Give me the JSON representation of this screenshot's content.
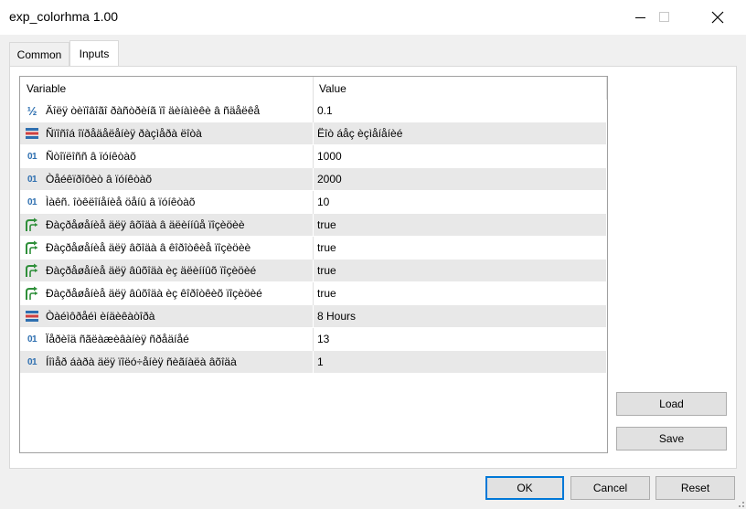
{
  "window": {
    "title": "exp_colorhma 1.00"
  },
  "tabs": [
    {
      "label": "Common"
    },
    {
      "label": "Inputs"
    }
  ],
  "grid": {
    "col_variable": "Variable",
    "col_value": "Value",
    "rows": [
      {
        "icon": "fraction-icon",
        "name": "Äîëÿ òèïîâîãî ðàñòðèíã ïî äèíàìèêè â ñäåëêå",
        "value": "0.1"
      },
      {
        "icon": "enum-icon",
        "name": "Ñïîñîá îïðåäåëåíèÿ ðàçìåðà ëîòà",
        "value": "Ëîò áåç èçìåíåíèé"
      },
      {
        "icon": "integer-icon",
        "name": "Ñòîïëîññ â ïóíêòàõ",
        "value": "1000"
      },
      {
        "icon": "integer-icon",
        "name": "Òåéêïðîôèò â ïóíêòàõ",
        "value": "2000"
      },
      {
        "icon": "integer-icon",
        "name": "Ìàêñ. îòêëîíåíèå öåíû â ïóíêòàõ",
        "value": "10"
      },
      {
        "icon": "bool-icon",
        "name": "Ðàçðåøåíèå äëÿ âõîäà â äëèííûå ïîçèöèè",
        "value": "true"
      },
      {
        "icon": "bool-icon",
        "name": "Ðàçðåøåíèå äëÿ âõîäà â êîðîòêèå ïîçèöèè",
        "value": "true"
      },
      {
        "icon": "bool-icon",
        "name": "Ðàçðåøåíèå äëÿ âûõîäà èç äëèííûõ ïîçèöèé",
        "value": "true"
      },
      {
        "icon": "bool-icon",
        "name": "Ðàçðåøåíèå äëÿ âûõîäà èç êîðîòêèõ ïîçèöèé",
        "value": "true"
      },
      {
        "icon": "enum-icon",
        "name": "Òàéìôðåéì èíäèêàòîðà",
        "value": "8 Hours"
      },
      {
        "icon": "integer-icon",
        "name": "Ïåðèîä ñãëàæèâàíèÿ ñðåäíåé",
        "value": "13"
      },
      {
        "icon": "integer-icon",
        "name": "Íîìåð áàðà äëÿ ïîëó÷åíèÿ ñèãíàëà âõîäà",
        "value": "1"
      }
    ]
  },
  "side_buttons": {
    "load": "Load",
    "save": "Save"
  },
  "footer_buttons": {
    "ok": "OK",
    "cancel": "Cancel",
    "reset": "Reset"
  },
  "colors": {
    "accent": "#0078d7",
    "icon_blue": "#2e6fb0",
    "icon_green": "#2f8f3a",
    "icon_red": "#d04040",
    "row_alt": "#e8e8e8"
  }
}
